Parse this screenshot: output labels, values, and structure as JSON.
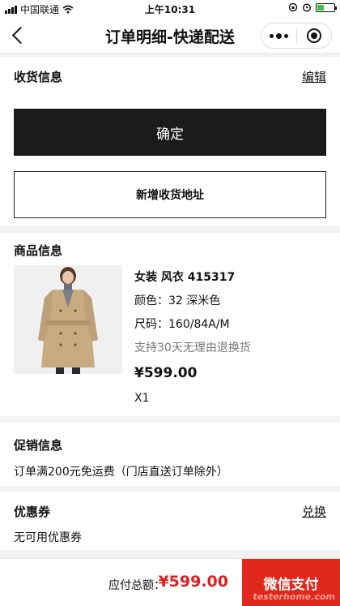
{
  "status_bar": {
    "carrier": "中国联通",
    "time": "上午10:31"
  },
  "nav": {
    "title": "订单明细-快递配送"
  },
  "shipping": {
    "title": "收货信息",
    "edit_label": "编辑",
    "confirm_label": "确定",
    "add_address_label": "新增收货地址"
  },
  "product": {
    "title": "商品信息",
    "name": "女装 风衣 415317",
    "color": "颜色：32 深米色",
    "size": "尺码：160/84A/M",
    "policy": "支持30天无理由退换货",
    "price": "¥599.00",
    "quantity": "X1"
  },
  "promo": {
    "title": "促销信息",
    "text": "订单满200元免运费（门店直送订单除外）"
  },
  "coupon": {
    "title": "优惠券",
    "change_label": "兑换",
    "text": "无可用优惠券"
  },
  "footer": {
    "total_label": "应付总额：",
    "total_value": "¥599.00",
    "pay_label": "微信支付",
    "watermark": "testerhome.com"
  },
  "colors": {
    "accent_red": "#e0281c",
    "dark_button": "#1b1b1b"
  }
}
